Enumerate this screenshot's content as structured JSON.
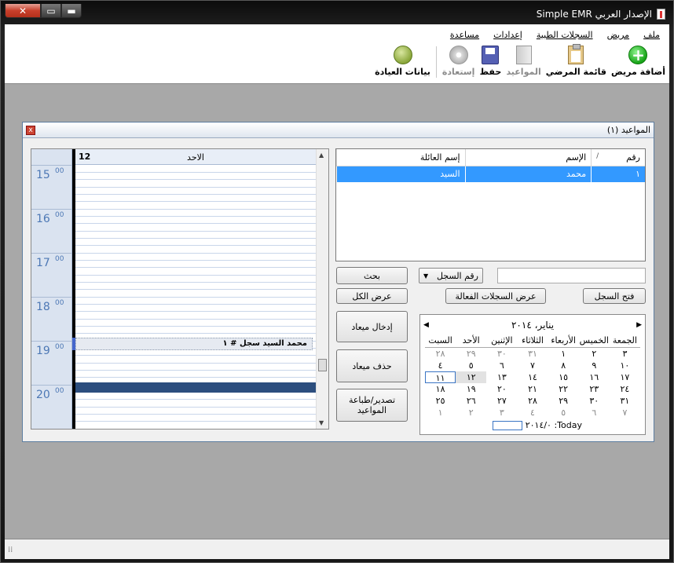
{
  "window": {
    "title": "Simple EMR الإصدار العربي",
    "close_glyph": "✕",
    "max_glyph": "▭",
    "min_glyph": "▬"
  },
  "menu": [
    "ملف",
    "مريض",
    "السجلات الطبية",
    "إعدادات",
    "مساعدة"
  ],
  "toolbar": [
    {
      "label": "أضافة مريض",
      "icon": "add-patient-icon",
      "enabled": true
    },
    {
      "label": "قائمة المرضي",
      "icon": "patient-list-icon",
      "enabled": true
    },
    {
      "label": "المواعيد",
      "icon": "appointments-icon",
      "enabled": false
    },
    {
      "label": "حفظ",
      "icon": "save-icon",
      "enabled": true
    },
    {
      "label": "إستعادة",
      "icon": "restore-icon",
      "enabled": false
    },
    {
      "label": "بيانات العيادة",
      "icon": "clinic-data-icon",
      "enabled": true
    }
  ],
  "dialog": {
    "title": "المواعيد (١)",
    "close_glyph": "x"
  },
  "patients_table": {
    "columns": [
      "رقم",
      "الإسم",
      "إسم العائلة"
    ],
    "sort_mark": "/",
    "rows": [
      {
        "id": "١",
        "name": "محمد",
        "family": "السيد"
      }
    ]
  },
  "search": {
    "field_value": "",
    "combo_value": "رقم السجل",
    "combo_arrow": "▼",
    "search_button": "بحث",
    "show_all": "عرض الكل",
    "open_record": "فتح السجل",
    "show_active": "عرض السجلات الفعالة"
  },
  "actions": {
    "add_appt": "إدخال ميعاد",
    "delete_appt": "حذف ميعاد",
    "export": "تصدير/طباعة المواعيد"
  },
  "calendar": {
    "month": "يناير، ٢٠١٤",
    "prev": "◀",
    "next": "▶",
    "days": [
      "السبت",
      "الأحد",
      "الإثنين",
      "الثلاثاء",
      "الأربعاء",
      "الخميس",
      "الجمعة"
    ],
    "weeks": [
      [
        "٢٨",
        "٢٩",
        "٣٠",
        "٣١",
        "١",
        "٢",
        "٣"
      ],
      [
        "٤",
        "٥",
        "٦",
        "٧",
        "٨",
        "٩",
        "١٠"
      ],
      [
        "١١",
        "١٢",
        "١٣",
        "١٤",
        "١٥",
        "١٦",
        "١٧"
      ],
      [
        "١٨",
        "١٩",
        "٢٠",
        "٢١",
        "٢٢",
        "٢٣",
        "٢٤"
      ],
      [
        "٢٥",
        "٢٦",
        "٢٧",
        "٢٨",
        "٢٩",
        "٣٠",
        "٣١"
      ],
      [
        "١",
        "٢",
        "٣",
        "٤",
        "٥",
        "٦",
        "٧"
      ]
    ],
    "muted_week0": [
      true,
      true,
      true,
      true,
      false,
      false,
      false
    ],
    "muted_week5": [
      true,
      true,
      true,
      true,
      true,
      true,
      true
    ],
    "today_label": "Today: ٢٠١٤/٠"
  },
  "schedule": {
    "day_number": "12",
    "day_name": "الاحد",
    "hours": [
      "15",
      "16",
      "17",
      "18",
      "19",
      "20"
    ],
    "minutes": "00",
    "appointment": "محمد السيد سجل # ١",
    "scroll_up": "▲",
    "scroll_down": "▼"
  },
  "status": {
    "grip": "⁞⁞"
  }
}
